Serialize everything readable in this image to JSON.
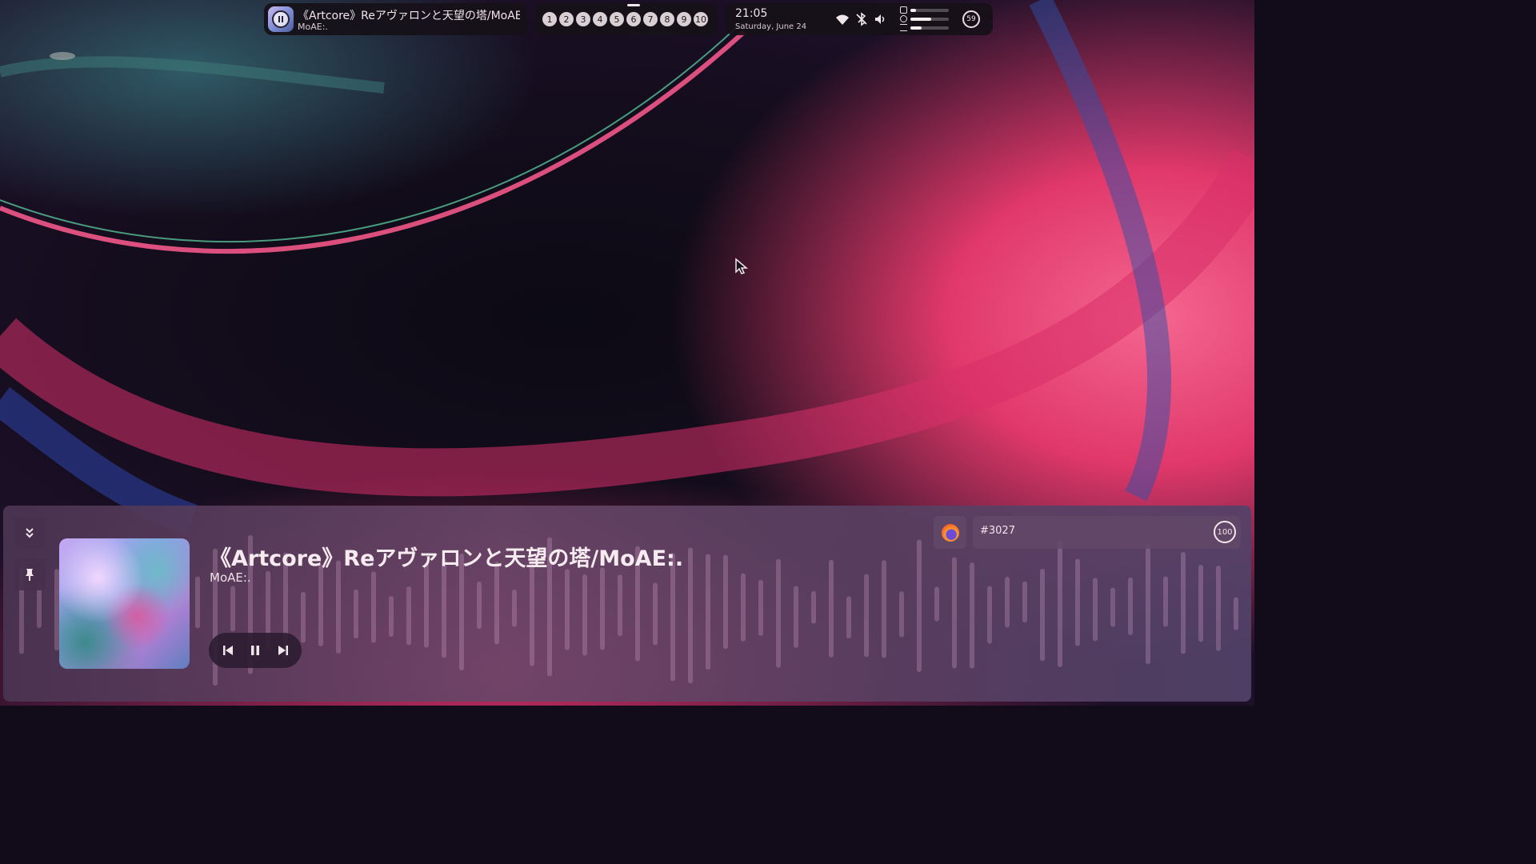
{
  "topbar": {
    "media": {
      "title": "《Artcore》Reアヴァロンと天望の塔/MoAE:.",
      "artist": "MoAE:.",
      "state_icon": "pause-icon"
    },
    "workspaces": [
      "1",
      "2",
      "3",
      "4",
      "5",
      "6",
      "7",
      "8",
      "9",
      "10"
    ],
    "active_workspace": "6",
    "clock": {
      "time": "21:05",
      "date": "Saturday, June 24"
    },
    "status_icons": [
      "wifi-icon",
      "bluetooth-off-icon",
      "volume-icon"
    ],
    "resources": [
      {
        "icon": "memory-icon",
        "level": 0.15
      },
      {
        "icon": "cpu-icon",
        "level": 0.55
      },
      {
        "icon": "swap-icon",
        "level": 0.3
      }
    ],
    "battery": "59"
  },
  "player": {
    "title": "《Artcore》Reアヴァロンと天望の塔/MoAE:.",
    "artist": "MoAE:.",
    "collapse_icon": "chevrons-down-icon",
    "pin_icon": "pin-icon",
    "controls": [
      "previous-icon",
      "pause-icon",
      "next-icon"
    ],
    "browser_icon": "firefox-icon",
    "search_value": "#3027",
    "volume": "100"
  },
  "colors": {
    "accent": "#e0386a",
    "panel": "#5a4062",
    "text": "#f1e6ea"
  }
}
